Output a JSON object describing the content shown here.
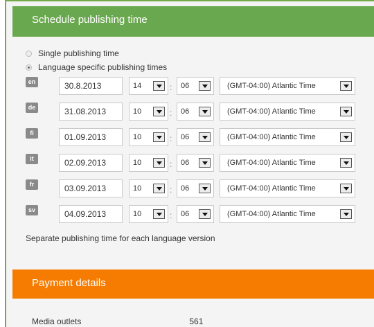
{
  "schedule": {
    "title": "Schedule publishing time",
    "options": [
      {
        "label": "Single publishing time",
        "checked": false
      },
      {
        "label": "Language specific publishing times",
        "checked": true
      }
    ],
    "rows": [
      {
        "lang": "en",
        "date": "30.8.2013",
        "hour": "14",
        "minute": "06",
        "timezone": "(GMT-04:00) Atlantic Time"
      },
      {
        "lang": "de",
        "date": "31.08.2013",
        "hour": "10",
        "minute": "06",
        "timezone": "(GMT-04:00) Atlantic Time"
      },
      {
        "lang": "fi",
        "date": "01.09.2013",
        "hour": "10",
        "minute": "06",
        "timezone": "(GMT-04:00) Atlantic Time"
      },
      {
        "lang": "it",
        "date": "02.09.2013",
        "hour": "10",
        "minute": "06",
        "timezone": "(GMT-04:00) Atlantic Time"
      },
      {
        "lang": "fr",
        "date": "03.09.2013",
        "hour": "10",
        "minute": "06",
        "timezone": "(GMT-04:00) Atlantic Time"
      },
      {
        "lang": "sv",
        "date": "04.09.2013",
        "hour": "10",
        "minute": "06",
        "timezone": "(GMT-04:00) Atlantic Time"
      }
    ],
    "time_separator": ":",
    "note": "Separate publishing time for each language version"
  },
  "payment": {
    "title": "Payment details",
    "rows": [
      {
        "label": "Media outlets",
        "value": "561"
      }
    ]
  },
  "colors": {
    "schedule_header": "#6aa84f",
    "payment_header": "#f57c00",
    "lang_badge": "#8a8a8a"
  }
}
